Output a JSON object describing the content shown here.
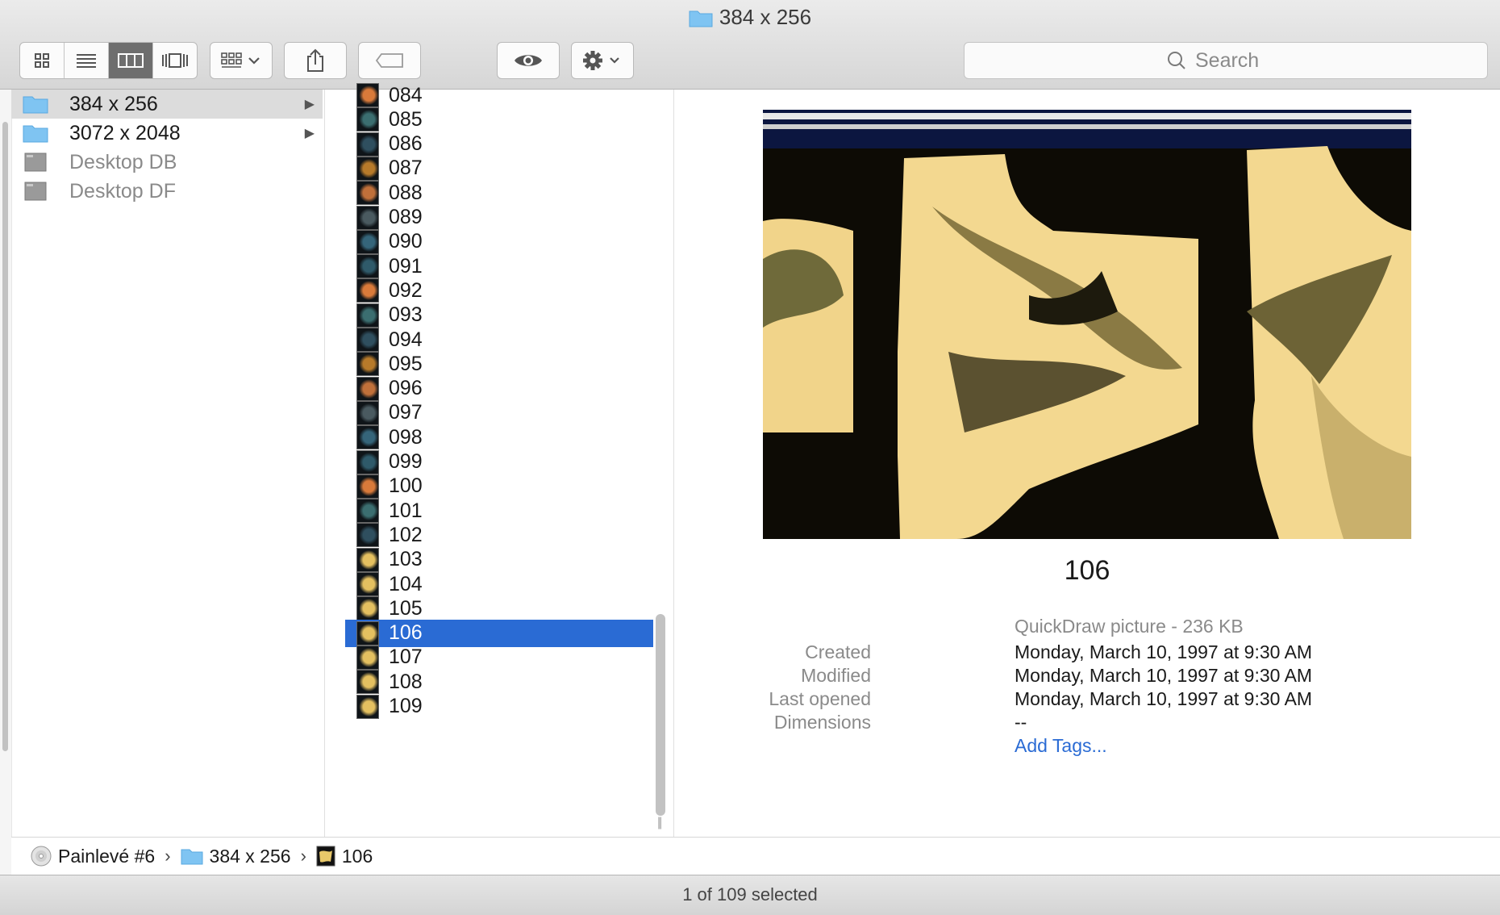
{
  "window": {
    "title": "384 x 256",
    "colors": {
      "selection": "#2a6bd4",
      "folder": "#7fc4f2",
      "link": "#2a6bd4"
    }
  },
  "toolbar": {
    "view_buttons": [
      "icon-view-icon",
      "list-view-icon",
      "column-view-icon",
      "cover-flow-icon"
    ],
    "active_view": "column-view-icon",
    "search": {
      "placeholder": "Search"
    }
  },
  "sidebar_column": {
    "items": [
      {
        "label": "384 x 256",
        "icon": "folder-icon",
        "selected": true,
        "has_children": true
      },
      {
        "label": "3072 x 2048",
        "icon": "folder-icon",
        "selected": false,
        "has_children": true
      },
      {
        "label": "Desktop DB",
        "icon": "file-icon",
        "selected": false,
        "has_children": false
      },
      {
        "label": "Desktop DF",
        "icon": "file-icon",
        "selected": false,
        "has_children": false
      }
    ]
  },
  "files": {
    "items": [
      "084",
      "085",
      "086",
      "087",
      "088",
      "089",
      "090",
      "091",
      "092",
      "093",
      "094",
      "095",
      "096",
      "097",
      "098",
      "099",
      "100",
      "101",
      "102",
      "103",
      "104",
      "105",
      "106",
      "107",
      "108",
      "109"
    ],
    "selected": "106"
  },
  "preview": {
    "name": "106",
    "kind": "QuickDraw picture - 236 KB",
    "fields": [
      {
        "key": "Created",
        "value": "Monday, March 10, 1997 at 9:30 AM"
      },
      {
        "key": "Modified",
        "value": "Monday, March 10, 1997 at 9:30 AM"
      },
      {
        "key": "Last opened",
        "value": "Monday, March 10, 1997 at 9:30 AM"
      },
      {
        "key": "Dimensions",
        "value": "--"
      }
    ],
    "add_tags": "Add Tags..."
  },
  "pathbar": {
    "items": [
      {
        "label": "Painlevé #6",
        "icon": "disc-icon"
      },
      {
        "label": "384 x 256",
        "icon": "folder-icon"
      },
      {
        "label": "106",
        "icon": "image-file-icon"
      }
    ]
  },
  "status": {
    "text": "1 of 109 selected"
  }
}
